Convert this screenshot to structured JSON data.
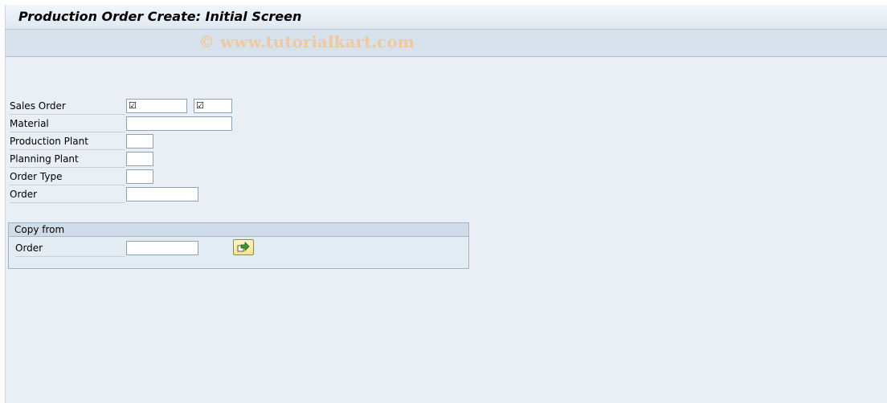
{
  "window": {
    "title": "Production Order Create: Initial Screen",
    "watermark": "© www.tutorialkart.com"
  },
  "form": {
    "sales_order_label": "Sales Order",
    "sales_order_value": "",
    "sales_order_item_value": "",
    "material_label": "Material",
    "material_value": "",
    "production_plant_label": "Production Plant",
    "production_plant_value": "",
    "planning_plant_label": "Planning Plant",
    "planning_plant_value": "",
    "order_type_label": "Order Type",
    "order_type_value": "",
    "order_label": "Order",
    "order_value": ""
  },
  "copy_from": {
    "title": "Copy from",
    "order_label": "Order",
    "order_value": ""
  },
  "icons": {
    "required_field": "required-checkbox-icon",
    "execute": "execute-arrow-icon"
  },
  "colors": {
    "background": "#e9eff5",
    "title_bar": "#dfe8f1",
    "exec_button": "#f3e487",
    "watermark": "#f0c8a0"
  }
}
